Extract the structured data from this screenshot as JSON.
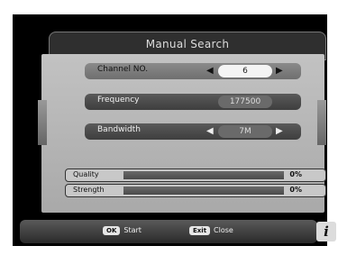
{
  "title": "Manual Search",
  "rows": {
    "channel": {
      "label": "Channel NO.",
      "value": "6"
    },
    "frequency": {
      "label": "Frequency",
      "value": "177500"
    },
    "bandwidth": {
      "label": "Bandwidth",
      "value": "7M"
    }
  },
  "arrows": {
    "left": "◀",
    "right": "▶"
  },
  "meters": {
    "quality": {
      "label": "Quality",
      "value": "0%",
      "level": 0
    },
    "strength": {
      "label": "Strength",
      "value": "0%",
      "level": 0
    }
  },
  "footer": {
    "ok_key": "OK",
    "ok_label": "Start",
    "exit_key": "Exit",
    "exit_label": "Close",
    "info_icon": "i"
  },
  "icons": {
    "info": "info-icon"
  }
}
